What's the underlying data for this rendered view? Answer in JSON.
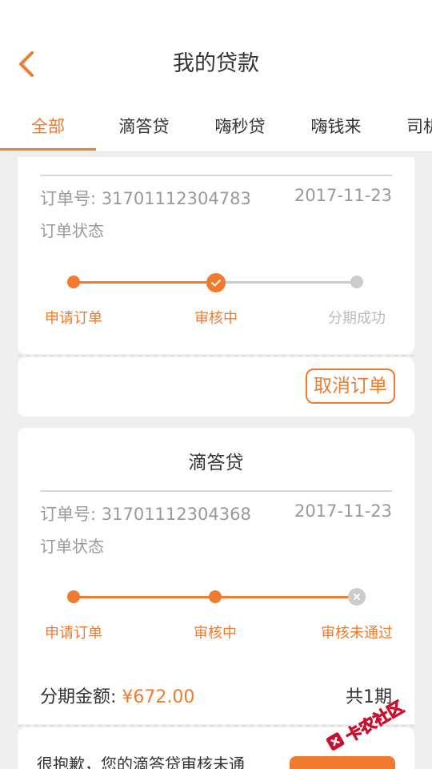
{
  "header": {
    "title": "我的贷款",
    "back_icon": "chevron-left-icon"
  },
  "tabs": [
    {
      "label": "全部",
      "active": true
    },
    {
      "label": "滴答贷",
      "active": false
    },
    {
      "label": "嗨秒贷",
      "active": false
    },
    {
      "label": "嗨钱来",
      "active": false
    },
    {
      "label": "司机",
      "active": false
    }
  ],
  "orders": [
    {
      "order_label": "订单号: 31701112304783",
      "date": "2017-11-23",
      "status_title": "订单状态",
      "steps": [
        "申请订单",
        "审核中",
        "分期成功"
      ],
      "progress_step": 2,
      "cancel_label": "取消订单"
    },
    {
      "title": "滴答贷",
      "order_label": "订单号: 31701112304368",
      "date": "2017-11-23",
      "status_title": "订单状态",
      "steps": [
        "申请订单",
        "审核中",
        "审核未通过"
      ],
      "progress_step": 3,
      "amount_label": "分期金额: ",
      "amount_value": "¥672.00",
      "period": "共1期",
      "message": "很抱歉，您的滴答贷审核未通"
    }
  ],
  "watermark": {
    "text": "卡农社区"
  },
  "colors": {
    "accent": "#f07a2d",
    "inactive": "#cccccc",
    "muted": "#999999"
  }
}
